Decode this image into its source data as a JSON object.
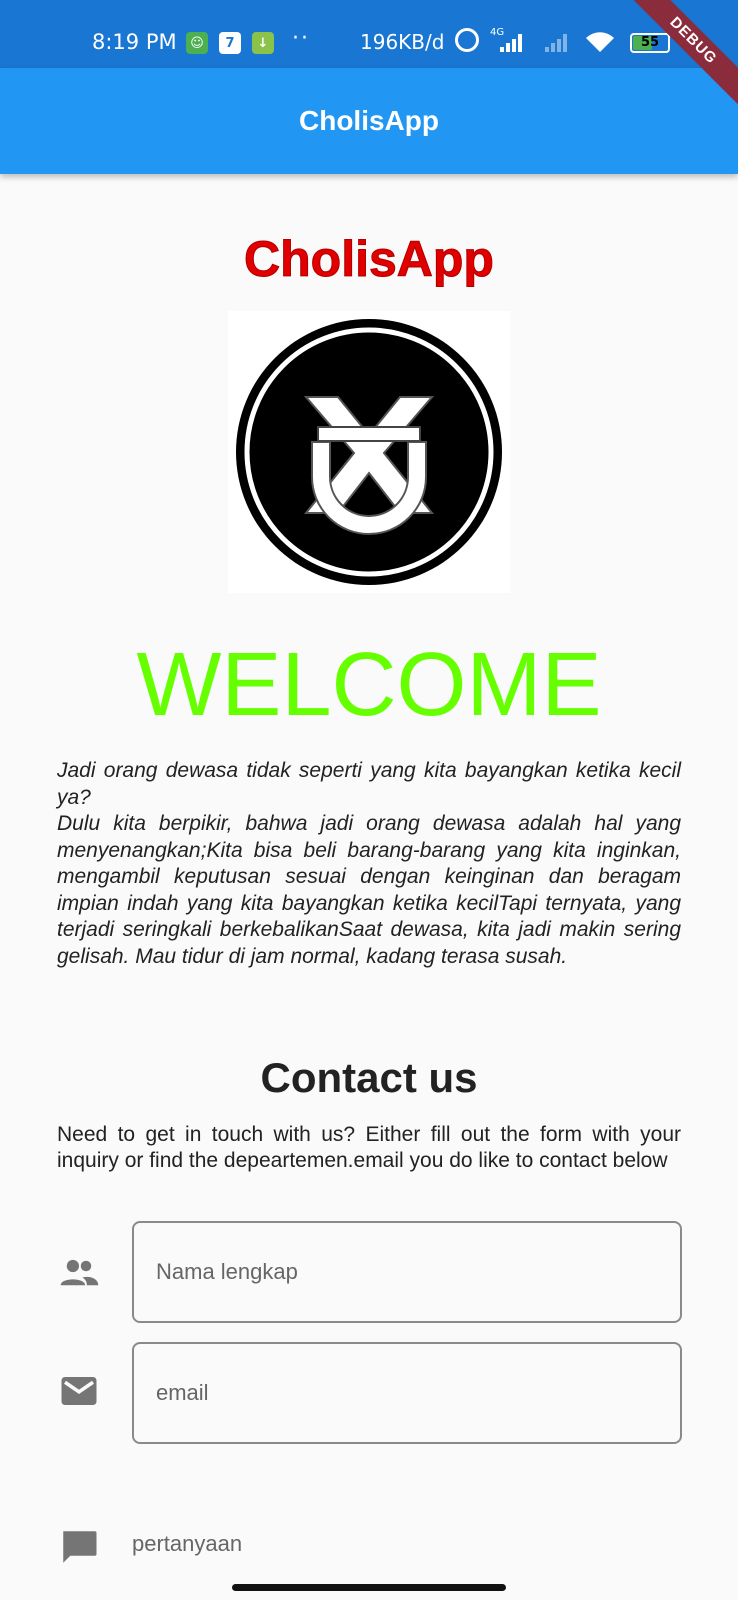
{
  "status_bar": {
    "time": "8:19 PM",
    "app_icon_2_label": "7",
    "dots": "··",
    "network_speed": "196KB/d",
    "network_type": "4G",
    "battery_level": "55",
    "debug_label": "DEBUG"
  },
  "app_bar": {
    "title": "CholisApp",
    "color": "#2196f3"
  },
  "main": {
    "brand_title": "CholisApp",
    "welcome": "WELCOME",
    "intro_paragraphs": [
      "Jadi orang dewasa tidak seperti yang kita bayangkan ketika kecil ya?",
      "Dulu kita berpikir, bahwa jadi orang dewasa adalah hal yang menyenangkan;Kita bisa beli barang-barang yang kita inginkan, mengambil keputusan sesuai dengan keinginan dan beragam impian indah yang kita bayangkan ketika kecilTapi ternyata, yang terjadi seringkali berkebalikanSaat dewasa, kita jadi makin sering gelisah. Mau tidur di jam normal, kadang terasa susah."
    ]
  },
  "contact": {
    "title": "Contact us",
    "description": "Need to get in touch with us? Either fill out the form with your inquiry or find the depeartemen.email you do like to contact below",
    "fields": {
      "name_placeholder": "Nama lengkap",
      "email_placeholder": "email",
      "question_label": "pertanyaan"
    },
    "icons": {
      "name": "people-icon",
      "email": "mail-icon",
      "question": "message-icon"
    }
  },
  "colors": {
    "brand_red": "#e00000",
    "welcome_green": "#66ff00",
    "status_bar": "#1976d2"
  }
}
